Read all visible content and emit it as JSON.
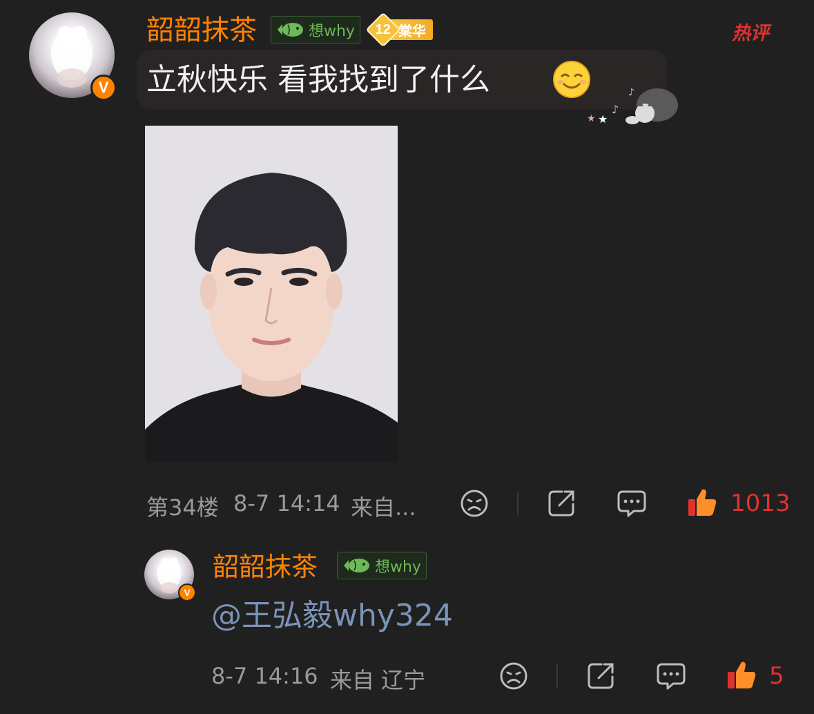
{
  "comment": {
    "username": "韶韶抹茶",
    "fan_badge": "想why",
    "level_number": "12",
    "level_label": "棠华",
    "hot_tag": "热评",
    "text": "立秋快乐 看我找到了什么",
    "verified_badge": "V",
    "floor": "第34楼",
    "time": "8-7 14:14",
    "source": "来自...",
    "likes": "1013"
  },
  "reply": {
    "username": "韶韶抹茶",
    "fan_badge": "想why",
    "verified_badge": "V",
    "mention": "@王弘毅why324",
    "time": "8-7 14:16",
    "source": "来自 辽宁",
    "likes": "5"
  },
  "icons": {
    "avatar": "avatar-icon",
    "verified": "verified-v-icon",
    "fish": "fish-icon",
    "emoji": "smile-emoji-icon",
    "sticker": "cat-sticker-icon",
    "dislike": "sad-face-icon",
    "share": "share-icon",
    "comment": "comment-icon",
    "like": "thumbs-up-icon"
  },
  "colors": {
    "background": "#202020",
    "username": "#ff8200",
    "fan_badge": "#6fb858",
    "hot": "#e0322f",
    "like": "#e0322f",
    "mention": "#7a93b8",
    "meta": "#9a9a9a"
  }
}
